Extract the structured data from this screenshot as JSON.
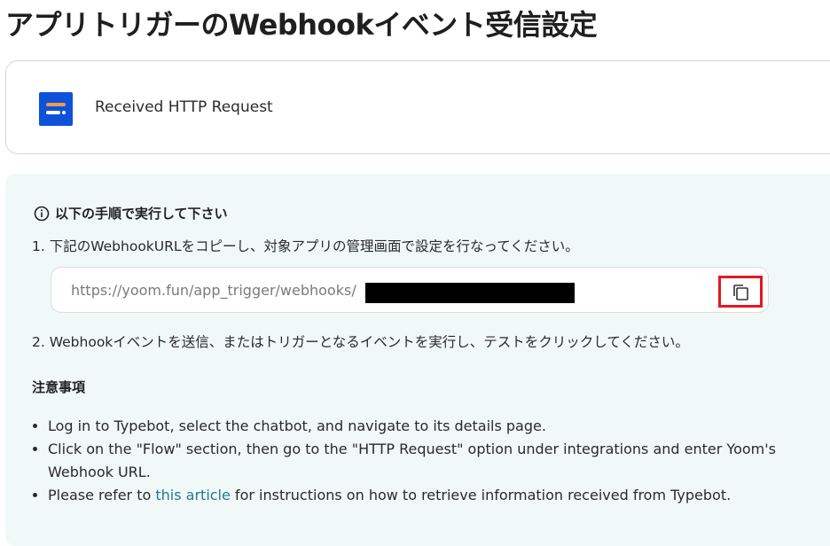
{
  "page": {
    "title": "アプリトリガーのWebhookイベント受信設定"
  },
  "trigger": {
    "name": "Received HTTP Request",
    "logo_icon": "typebot-logo-icon"
  },
  "instructions": {
    "heading": "以下の手順で実行して下さい",
    "info_icon": "info-circle-icon",
    "step1": "1. 下記のWebhookURLをコピーし、対象アプリの管理画面で設定を行なってください。",
    "webhook_url": "https://yoom.fun/app_trigger/webhooks/",
    "copy_icon": "copy-icon",
    "step2": "2. Webhookイベントを送信、またはトリガーとなるイベントを実行し、テストをクリックしてください。"
  },
  "notes": {
    "heading": "注意事項",
    "item1": "Log in to Typebot, select the chatbot, and navigate to its details page.",
    "item2": "Click on the \"Flow\" section, then go to the \"HTTP Request\" option under integrations and enter Yoom's Webhook URL.",
    "item3_prefix": "Please refer to ",
    "item3_link": "this article",
    "item3_suffix": " for instructions on how to retrieve information received from Typebot."
  },
  "colors": {
    "panel_bg": "#f1f8f8",
    "link": "#1f7a8c",
    "highlight": "#e3191f",
    "logo_bg": "#0f52d9"
  }
}
